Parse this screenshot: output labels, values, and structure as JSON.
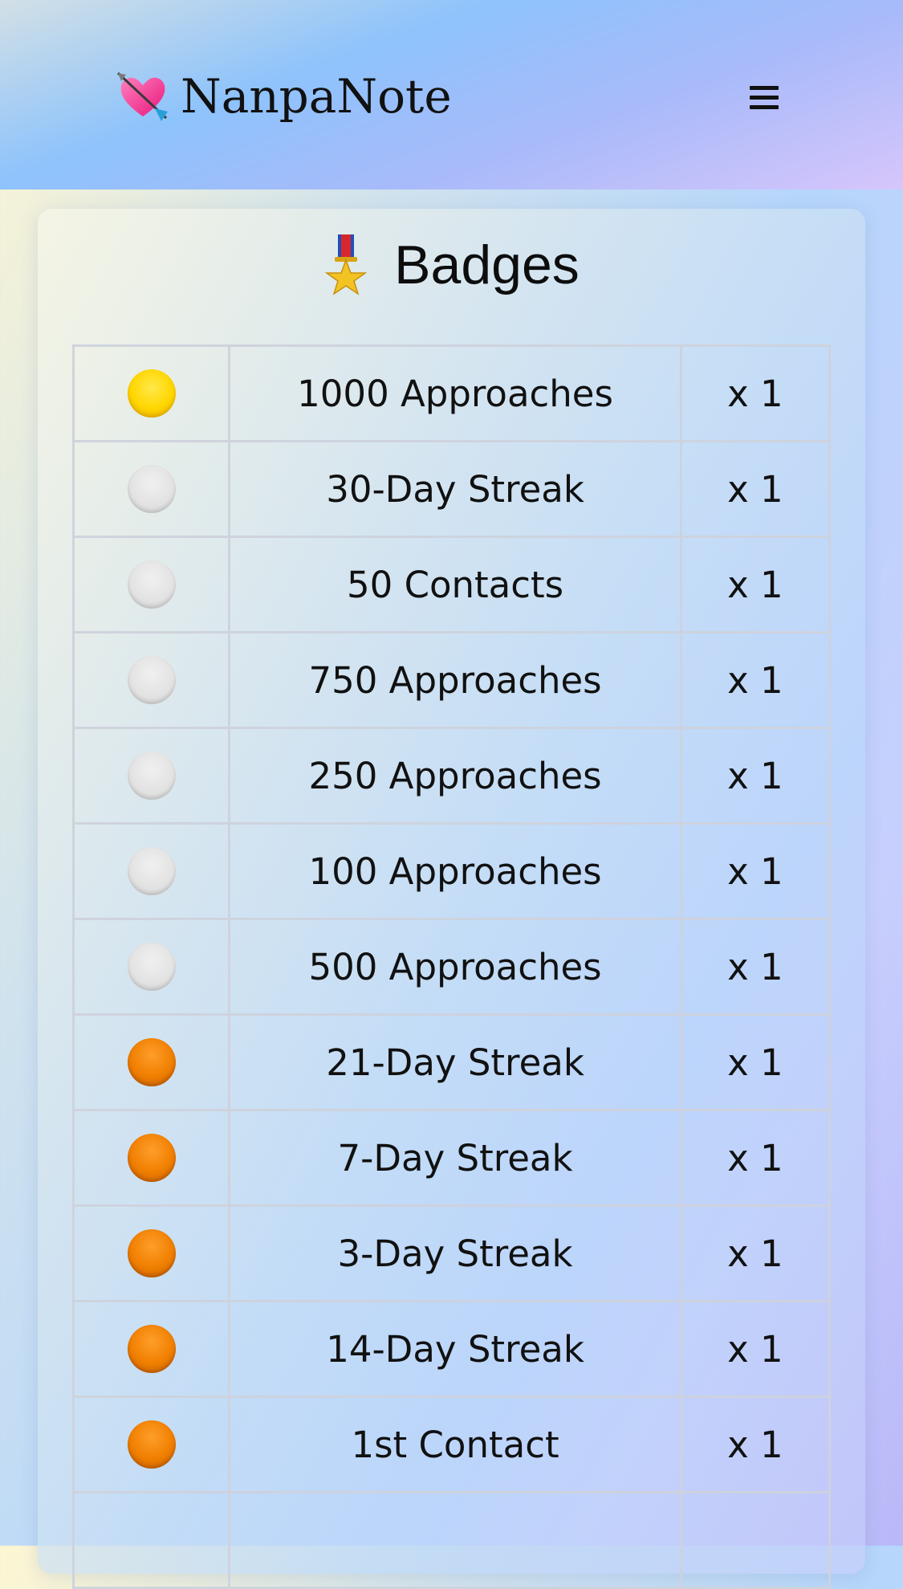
{
  "header": {
    "brand_icon": "heart-with-arrow-icon",
    "brand_name": "NanpaNote",
    "menu_icon": "hamburger-menu-icon"
  },
  "badges_card": {
    "title_icon": "military-medal-icon",
    "title": "Badges",
    "rows": [
      {
        "tier": "gold",
        "tier_color": "#ffd600",
        "name": "1000 Approaches",
        "count": "x 1"
      },
      {
        "tier": "silver",
        "tier_color": "#e2e2e2",
        "name": "30-Day Streak",
        "count": "x 1"
      },
      {
        "tier": "silver",
        "tier_color": "#e2e2e2",
        "name": "50 Contacts",
        "count": "x 1"
      },
      {
        "tier": "silver",
        "tier_color": "#e2e2e2",
        "name": "750 Approaches",
        "count": "x 1"
      },
      {
        "tier": "silver",
        "tier_color": "#e2e2e2",
        "name": "250 Approaches",
        "count": "x 1"
      },
      {
        "tier": "silver",
        "tier_color": "#e2e2e2",
        "name": "100 Approaches",
        "count": "x 1"
      },
      {
        "tier": "silver",
        "tier_color": "#e2e2e2",
        "name": "500 Approaches",
        "count": "x 1"
      },
      {
        "tier": "bronze",
        "tier_color": "#f07f00",
        "name": "21-Day Streak",
        "count": "x 1"
      },
      {
        "tier": "bronze",
        "tier_color": "#f07f00",
        "name": "7-Day Streak",
        "count": "x 1"
      },
      {
        "tier": "bronze",
        "tier_color": "#f07f00",
        "name": "3-Day Streak",
        "count": "x 1"
      },
      {
        "tier": "bronze",
        "tier_color": "#f07f00",
        "name": "14-Day Streak",
        "count": "x 1"
      },
      {
        "tier": "bronze",
        "tier_color": "#f07f00",
        "name": "1st Contact",
        "count": "x 1"
      },
      {
        "tier": "",
        "tier_color": "",
        "name": "",
        "count": ""
      }
    ]
  }
}
